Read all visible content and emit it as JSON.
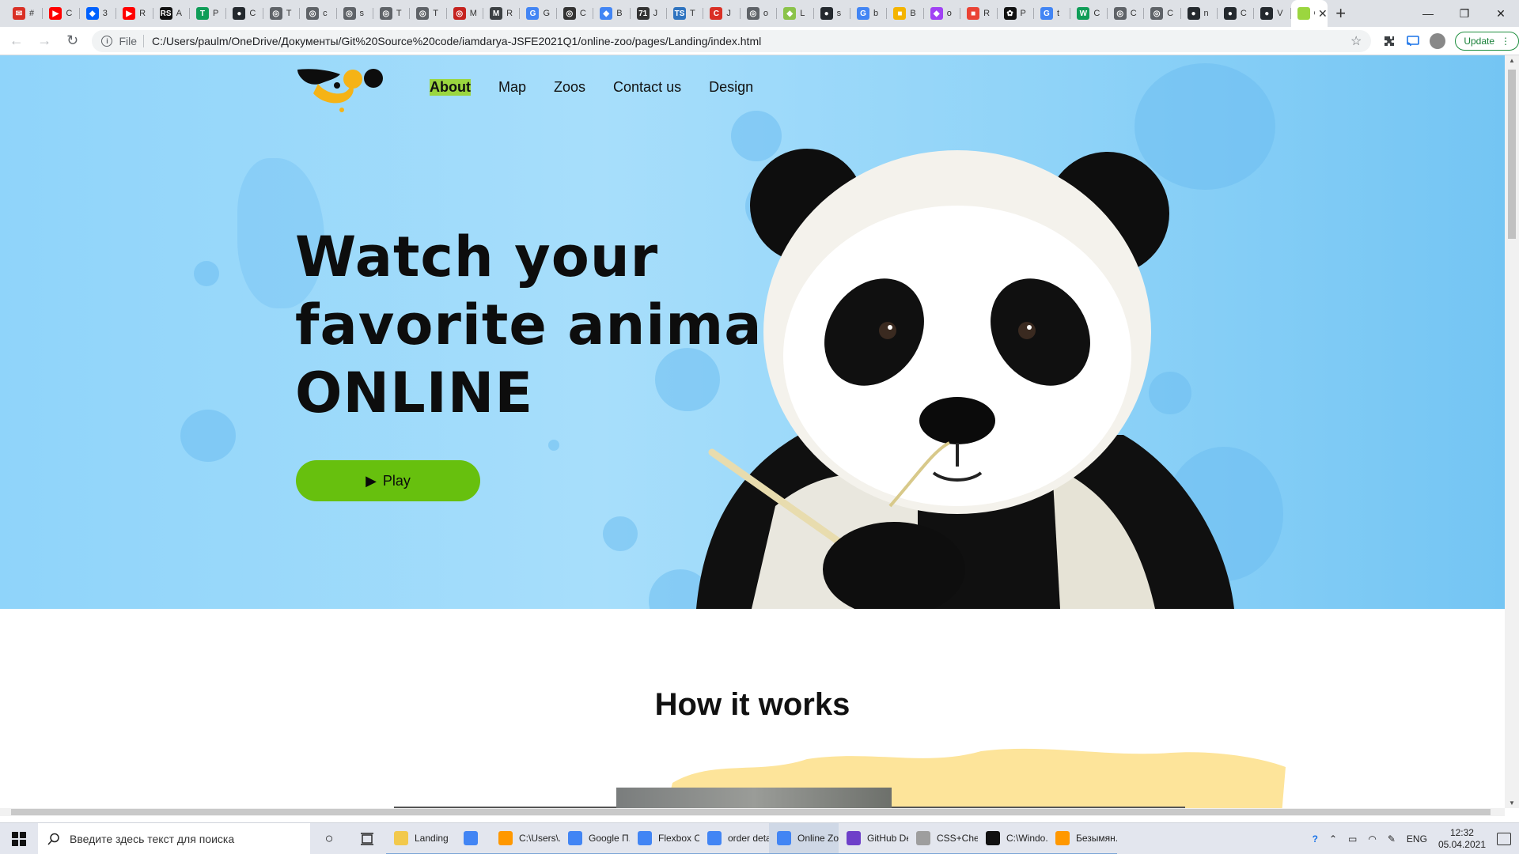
{
  "browser": {
    "tabs": [
      {
        "label": "#",
        "color": "#d93025",
        "glyph": "✉"
      },
      {
        "label": "C",
        "color": "#ff0000",
        "glyph": "▶"
      },
      {
        "label": "3",
        "color": "#0061fe",
        "glyph": "◆"
      },
      {
        "label": "R",
        "color": "#ff0000",
        "glyph": "▶"
      },
      {
        "label": "A",
        "color": "#111111",
        "glyph": "RS"
      },
      {
        "label": "P",
        "color": "#0f9d58",
        "glyph": "T"
      },
      {
        "label": "C",
        "color": "#24292e",
        "glyph": "●"
      },
      {
        "label": "T",
        "color": "#5f6368",
        "glyph": "◎"
      },
      {
        "label": "c",
        "color": "#5f6368",
        "glyph": "◎"
      },
      {
        "label": "s",
        "color": "#5f6368",
        "glyph": "◎"
      },
      {
        "label": "T",
        "color": "#5f6368",
        "glyph": "◎"
      },
      {
        "label": "T",
        "color": "#5f6368",
        "glyph": "◎"
      },
      {
        "label": "M",
        "color": "#c5221f",
        "glyph": "◎"
      },
      {
        "label": "R",
        "color": "#3c4043",
        "glyph": "M"
      },
      {
        "label": "G",
        "color": "#4285f4",
        "glyph": "G"
      },
      {
        "label": "C",
        "color": "#333333",
        "glyph": "◎"
      },
      {
        "label": "B",
        "color": "#4285f4",
        "glyph": "◆"
      },
      {
        "label": "J",
        "color": "#333333",
        "glyph": "71"
      },
      {
        "label": "T",
        "color": "#2f74c0",
        "glyph": "TS"
      },
      {
        "label": "J",
        "color": "#d93025",
        "glyph": "C"
      },
      {
        "label": "o",
        "color": "#5f6368",
        "glyph": "◎"
      },
      {
        "label": "L",
        "color": "#8bc34a",
        "glyph": "◆"
      },
      {
        "label": "s",
        "color": "#24292e",
        "glyph": "●"
      },
      {
        "label": "b",
        "color": "#4285f4",
        "glyph": "G"
      },
      {
        "label": "B",
        "color": "#f4b400",
        "glyph": "■"
      },
      {
        "label": "o",
        "color": "#a142f4",
        "glyph": "◆"
      },
      {
        "label": "R",
        "color": "#ea4335",
        "glyph": "■"
      },
      {
        "label": "P",
        "color": "#111111",
        "glyph": "✿"
      },
      {
        "label": "t",
        "color": "#4285f4",
        "glyph": "G"
      },
      {
        "label": "C",
        "color": "#0f9d58",
        "glyph": "W"
      },
      {
        "label": "C",
        "color": "#5f6368",
        "glyph": "◎"
      },
      {
        "label": "C",
        "color": "#5f6368",
        "glyph": "◎"
      },
      {
        "label": "n",
        "color": "#24292e",
        "glyph": "●"
      },
      {
        "label": "C",
        "color": "#24292e",
        "glyph": "●"
      },
      {
        "label": "V",
        "color": "#24292e",
        "glyph": "●"
      }
    ],
    "active_tab": {
      "label": "O",
      "close": "✕"
    },
    "new_tab": "+",
    "window_controls": {
      "minimize": "—",
      "restore": "❐",
      "close": "✕"
    },
    "toolbar": {
      "back": "←",
      "forward": "→",
      "reload": "↻",
      "info": "i",
      "scheme": "File",
      "url": "C:/Users/paulm/OneDrive/Документы/Git%20Source%20code/iamdarya-JSFE2021Q1/online-zoo/pages/Landing/index.html",
      "star": "☆",
      "update_label": "Update",
      "update_menu": "⋮"
    }
  },
  "page": {
    "nav": [
      "About",
      "Map",
      "Zoos",
      "Contact us",
      "Design"
    ],
    "headline": [
      "Watch your",
      "favorite animal",
      "ONLINE"
    ],
    "play_label": "Play",
    "play_icon": "▶",
    "section_title": "How it works",
    "colors": {
      "hero_bg": "#a7defb",
      "accent_green": "#67c00e",
      "nav_active_bg": "#9bd63f",
      "logo_yellow": "#f5b316",
      "paint_yellow": "#fde49a"
    }
  },
  "taskbar": {
    "search_placeholder": "Введите здесь текст для поиска",
    "apps": [
      {
        "label": "Landing",
        "color": "#f2c94c",
        "active": false
      },
      {
        "label": "",
        "color": "#4285f4",
        "active": false
      },
      {
        "label": "C:\\Users\\...",
        "color": "#ff9800",
        "active": false
      },
      {
        "label": "Google П...",
        "color": "#4285f4",
        "active": false
      },
      {
        "label": "Flexbox C...",
        "color": "#4285f4",
        "active": false
      },
      {
        "label": "order deta...",
        "color": "#4285f4",
        "active": false
      },
      {
        "label": "Online Zo...",
        "color": "#4285f4",
        "active": true
      },
      {
        "label": "GitHub De...",
        "color": "#6e40c9",
        "active": false
      },
      {
        "label": "CSS+Chea...",
        "color": "#9e9e9e",
        "active": false
      },
      {
        "label": "C:\\Windo...",
        "color": "#111111",
        "active": false
      },
      {
        "label": "Безымян...",
        "color": "#ff9800",
        "active": false
      }
    ],
    "tray": {
      "lang": "ENG",
      "time": "12:32",
      "date": "05.04.2021"
    }
  }
}
